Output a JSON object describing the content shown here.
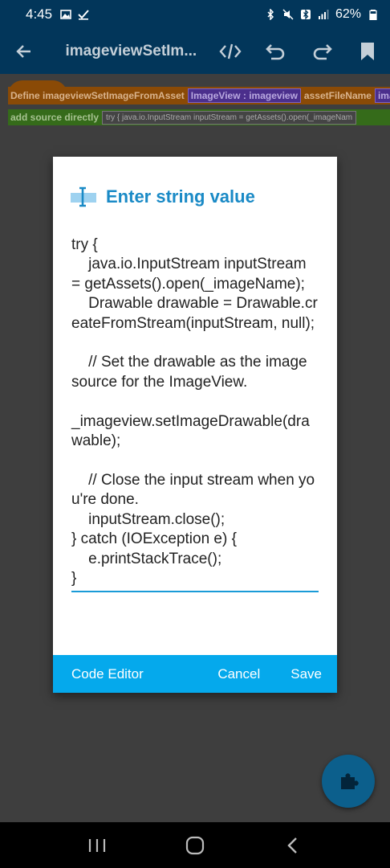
{
  "status_bar": {
    "time": "4:45",
    "battery": "62%",
    "left_icons": [
      "gallery-icon",
      "check-icon"
    ],
    "right_icons": [
      "bluetooth-icon",
      "mute-icon",
      "bluetooth-icon",
      "signal-icon",
      "battery-icon"
    ]
  },
  "app_bar": {
    "title": "imageviewSetIm...",
    "actions": [
      "code-icon",
      "undo-icon",
      "redo-icon",
      "bookmark-icon"
    ]
  },
  "blocks": {
    "define_label": "Define imageviewSetImageFromAsset",
    "param_imageview": "ImageView : imageview",
    "param_asset": "assetFileName",
    "param_image": "ima",
    "add_source_label": "add source directly",
    "add_source_code": "try {     java.io.InputStream inputStream = getAssets().open(_imageNam"
  },
  "dialog": {
    "title": "Enter string value",
    "code": "try {\n    java.io.InputStream inputStream = getAssets().open(_imageName);\n    Drawable drawable = Drawable.createFromStream(inputStream, null);\n\n    // Set the drawable as the image source for the ImageView.\n\n_imageview.setImageDrawable(drawable);\n\n    // Close the input stream when you're done.\n    inputStream.close();\n} catch (IOException e) {\n    e.printStackTrace();\n}",
    "code_editor_label": "Code Editor",
    "cancel_label": "Cancel",
    "save_label": "Save"
  },
  "colors": {
    "app_bar": "#02365a",
    "dialog_accent": "#05a9ec",
    "title_blue": "#1a8ac6"
  }
}
